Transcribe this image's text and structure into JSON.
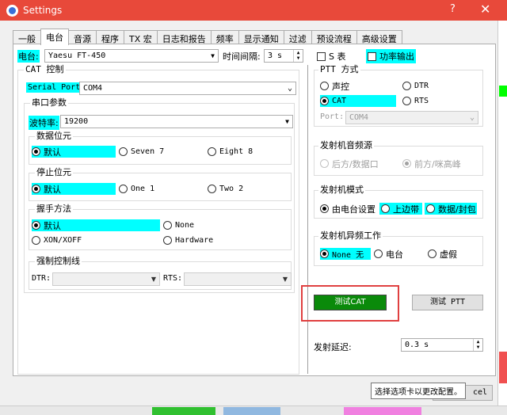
{
  "window": {
    "title": "Settings",
    "help": "?",
    "close": "✕"
  },
  "tabs": [
    "一般",
    "电台",
    "音源",
    "程序",
    "TX 宏",
    "日志和报告",
    "频率",
    "显示通知",
    "过滤",
    "预设流程",
    "高级设置"
  ],
  "radio": {
    "label": "电台:",
    "value": "Yaesu FT-450",
    "poll_label": "时间间隔:",
    "poll_value": "3 s"
  },
  "cat": {
    "title": "CAT 控制",
    "serial_port_label": "Serial Port",
    "serial_port_value": "COM4",
    "serial_params_title": "串口参数",
    "baud_label": "波特率:",
    "baud_value": "19200",
    "data_bits": {
      "title": "数据位元",
      "options": [
        "默认",
        "Seven 7",
        "Eight 8"
      ]
    },
    "stop_bits": {
      "title": "停止位元",
      "options": [
        "默认",
        "One 1",
        "Two 2"
      ]
    },
    "handshake": {
      "title": "握手方法",
      "options": [
        "默认",
        "None",
        "XON/XOFF",
        "Hardware"
      ]
    },
    "force_lines": {
      "title": "强制控制线",
      "dtr_label": "DTR:",
      "rts_label": "RTS:"
    }
  },
  "right": {
    "s_meter": "S 表",
    "power_out": "功率输出",
    "ptt": {
      "title": "PTT 方式",
      "options": [
        "声控",
        "DTR",
        "CAT",
        "RTS"
      ],
      "port_label": "Port:",
      "port_value": "COM4"
    },
    "tx_audio": {
      "title": "发射机音频源",
      "options": [
        "后方/数据口",
        "前方/咪高峰"
      ]
    },
    "mode": {
      "title": "发射机模式",
      "options": [
        "由电台设置",
        "上边带",
        "数据/封包"
      ]
    },
    "split": {
      "title": "发射机异频工作",
      "options": [
        "None 无",
        "电台",
        "虚假"
      ]
    },
    "test_cat": "测试CAT",
    "test_ptt": "测试 PTT",
    "tx_delay_label": "发射延迟:",
    "tx_delay_value": "0.3 s"
  },
  "tooltip": "选择选项卡以更改配置。",
  "cancel_partial": "cel"
}
